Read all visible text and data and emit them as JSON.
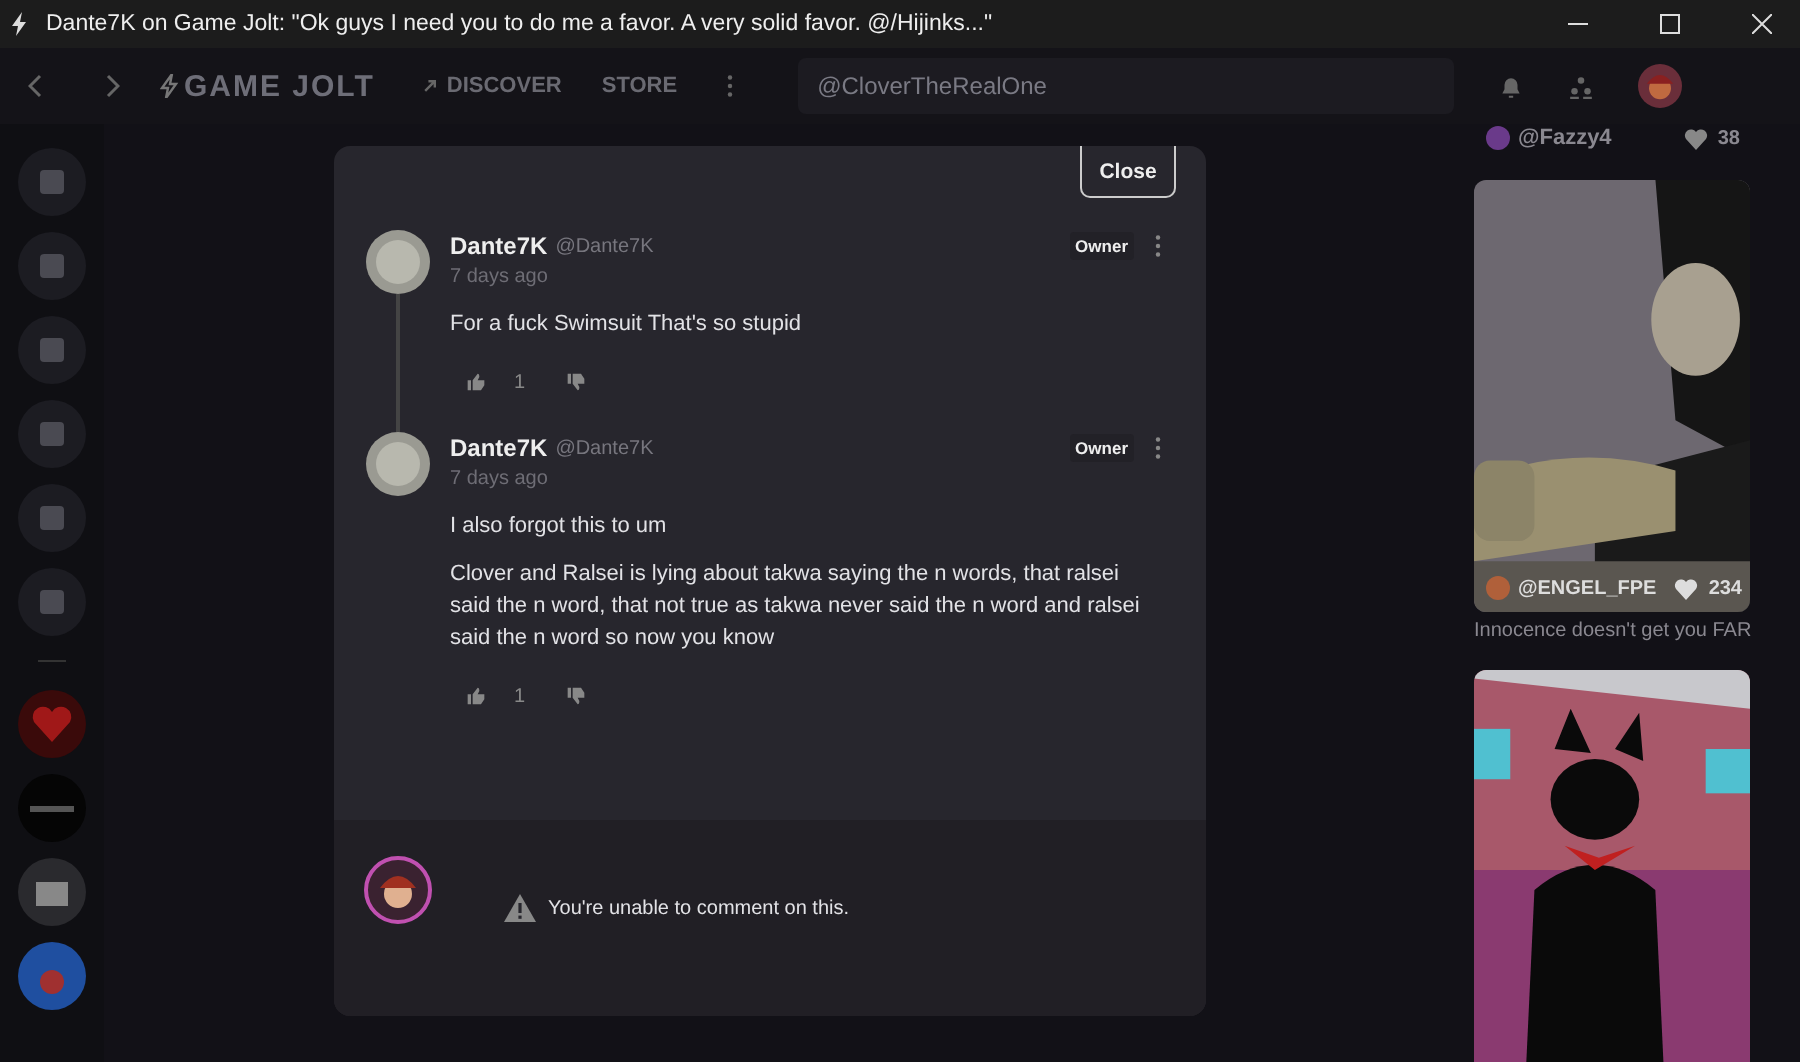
{
  "window": {
    "title": "Dante7K on Game Jolt: \"Ok guys I need you to do me a favor. A very solid favor. @/Hijinks...\""
  },
  "nav": {
    "logo": "GAME JOLT",
    "links": [
      {
        "label": "DISCOVER",
        "kind": "icon"
      },
      {
        "label": "STORE",
        "kind": "plain"
      }
    ],
    "search": {
      "value": "@CloverTheRealOne"
    }
  },
  "modal": {
    "close": "Close",
    "comments": [
      {
        "author": "Dante7K",
        "handle": "@Dante7K",
        "time": "7 days ago",
        "badge": "Owner",
        "paragraphs": [
          "For a fuck Swimsuit That's so stupid"
        ],
        "likes": "1",
        "thread": true
      },
      {
        "author": "Dante7K",
        "handle": "@Dante7K",
        "time": "7 days ago",
        "badge": "Owner",
        "paragraphs": [
          "I also forgot this to um",
          "Clover and Ralsei is lying about takwa saying the n words, that ralsei said the n word, that not true as takwa never said the n word and ralsei said the n word so now you know"
        ],
        "likes": "1",
        "thread": false
      }
    ],
    "notice": "You're unable to comment on this."
  },
  "feed": {
    "top": {
      "user": "@Fazzy4",
      "likes": "38"
    },
    "cards": [
      {
        "kind": "grey",
        "user": "@ENGEL_FPE",
        "likes": "234",
        "caption": "Innocence doesn't get you FAR"
      },
      {
        "kind": "pink"
      }
    ]
  }
}
